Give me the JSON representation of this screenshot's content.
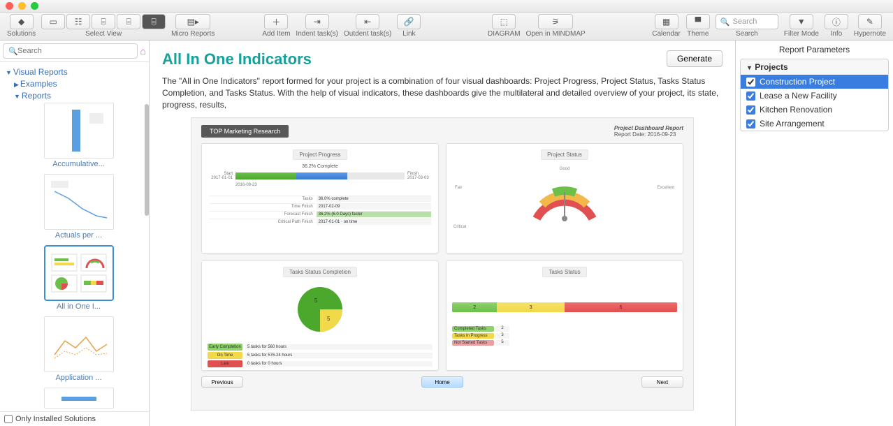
{
  "toolbar": {
    "solutions": "Solutions",
    "select_view": "Select View",
    "micro_reports": "Micro Reports",
    "add_item": "Add Item",
    "indent": "Indent task(s)",
    "outdent": "Outdent task(s)",
    "link": "Link",
    "diagram": "DIAGRAM",
    "open_mindmap": "Open in MINDMAP",
    "calendar": "Calendar",
    "theme": "Theme",
    "search": "Search",
    "search_placeholder": "Search",
    "filter_mode": "Filter Mode",
    "info": "Info",
    "hypernote": "Hypernote"
  },
  "left": {
    "search_placeholder": "Search",
    "root": "Visual Reports",
    "examples": "Examples",
    "reports": "Reports",
    "thumbs": [
      {
        "label": "Accumulative..."
      },
      {
        "label": "Actuals per ..."
      },
      {
        "label": "All in One I...",
        "selected": true
      },
      {
        "label": "Application ..."
      }
    ],
    "footer": "Only Installed Solutions"
  },
  "center": {
    "title": "All In One Indicators",
    "generate": "Generate",
    "description": "The \"All in One Indicators\" report formed for your project is a combination of four visual dashboards: Project Progress, Project Status, Tasks Status Completion, and Tasks Status. With the help of visual indicators, these dashboards give the multilateral and detailed overview of your project, its state, progress, results,",
    "dash": {
      "tag": "TOP Marketing Research",
      "report_title": "Project Dashboard Report",
      "report_date_label": "Report Date:",
      "report_date": "2016-09-23",
      "cards": {
        "progress": {
          "title": "Project Progress",
          "complete": "36.2% Complete",
          "start_lbl": "Start",
          "start": "2017-01-01",
          "finish_lbl": "Finish",
          "finish": "2017-03-03",
          "today": "2016-09-23",
          "rows": [
            {
              "k": "Tasks",
              "v": "36.0% complete"
            },
            {
              "k": "Time Finish",
              "v": "2017-02-09"
            },
            {
              "k": "Forecast Finish",
              "v": "36.2% (6.0 Days) faster",
              "hl": true
            },
            {
              "k": "Critical Path Finish",
              "v": "2017-01-01 · on time"
            }
          ]
        },
        "status": {
          "title": "Project Status",
          "labels": {
            "good": "Good",
            "fair": "Fair",
            "excellent": "Excellent",
            "critical": "Critical"
          }
        },
        "completion": {
          "title": "Tasks Status Completion",
          "legend": [
            {
              "label": "Early Completion",
              "color": "#8fd16c",
              "text": "5 tasks for 560 hours"
            },
            {
              "label": "On Time",
              "color": "#f2d94a",
              "text": "5 tasks for 576.24 hours"
            },
            {
              "label": "Late",
              "color": "#e05050",
              "text": "0 tasks for 0 hours"
            }
          ],
          "slices": [
            {
              "v": 5,
              "c": "#4ba82c"
            },
            {
              "v": 5,
              "c": "#f2d94a"
            }
          ]
        },
        "tstatus": {
          "title": "Tasks Status",
          "segments": [
            {
              "n": 2,
              "c": "#6cc04a"
            },
            {
              "n": 3,
              "c": "#f2d94a"
            },
            {
              "n": 5,
              "c": "#e05050"
            }
          ],
          "legend": [
            {
              "label": "Completed Tasks",
              "c": "#8fd16c",
              "n": 2
            },
            {
              "label": "Tasks In Progress",
              "c": "#f2d94a",
              "n": 3
            },
            {
              "label": "Not Started Tasks",
              "c": "#e8a0a0",
              "n": 5
            }
          ]
        }
      },
      "nav": {
        "prev": "Previous",
        "home": "Home",
        "next": "Next"
      }
    }
  },
  "right": {
    "header": "Report Parameters",
    "projects_label": "Projects",
    "projects": [
      "Construction Project",
      "Lease a New Facility",
      "Kitchen Renovation",
      "Site Arrangement"
    ]
  },
  "chart_data": [
    {
      "type": "bar",
      "title": "Project Progress",
      "categories": [
        "complete"
      ],
      "values": [
        36.2
      ],
      "ylim": [
        0,
        100
      ],
      "xlabel": "",
      "ylabel": "%"
    },
    {
      "type": "pie",
      "title": "Tasks Status Completion",
      "series": [
        {
          "name": "Early Completion",
          "values": [
            5
          ]
        },
        {
          "name": "On Time",
          "values": [
            5
          ]
        },
        {
          "name": "Late",
          "values": [
            0
          ]
        }
      ]
    },
    {
      "type": "bar",
      "title": "Tasks Status",
      "categories": [
        "Completed",
        "In Progress",
        "Not Started"
      ],
      "values": [
        2,
        3,
        5
      ]
    }
  ]
}
